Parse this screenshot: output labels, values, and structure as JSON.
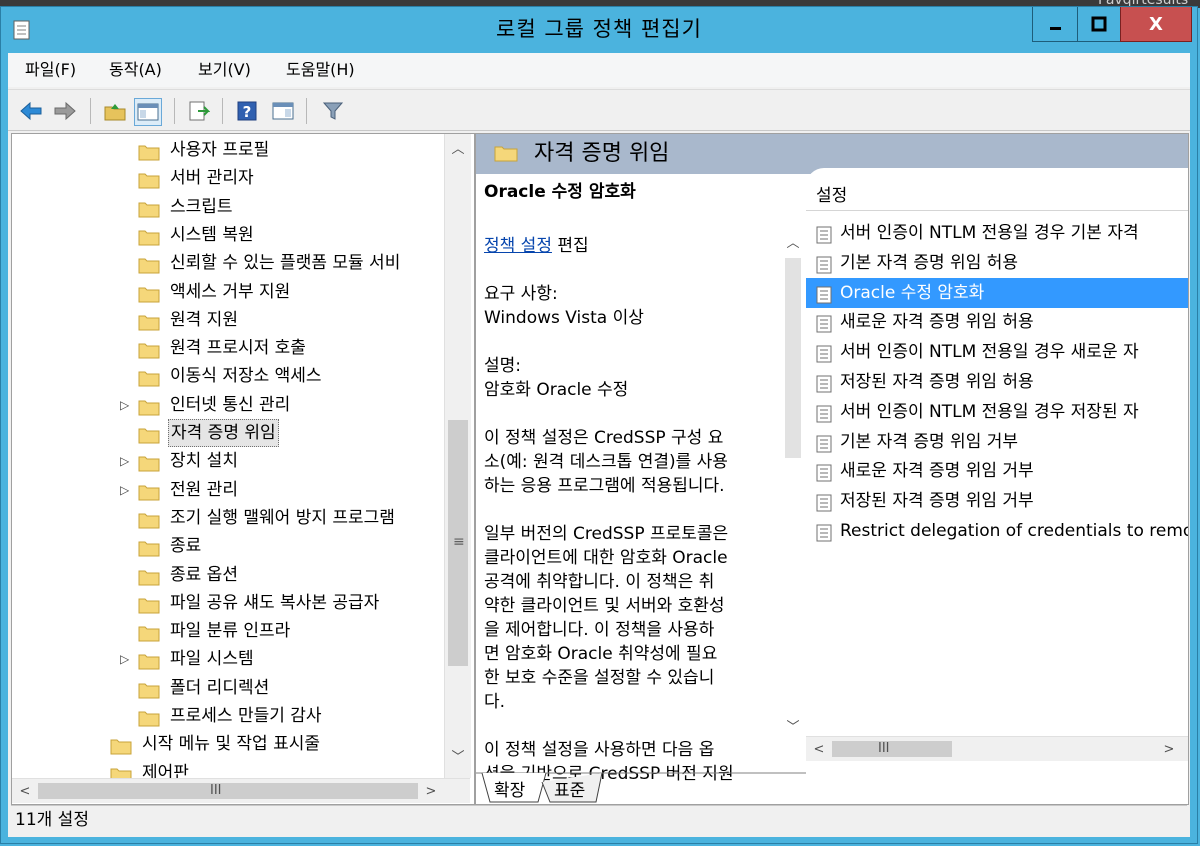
{
  "window": {
    "title": "로컬 그룹 정책 편집기",
    "close_glyph": "X"
  },
  "menu": [
    {
      "label": "파일(F)"
    },
    {
      "label": "동작(A)"
    },
    {
      "label": "보기(V)"
    },
    {
      "label": "도움말(H)"
    }
  ],
  "toolbar": {
    "icons": [
      "back-arrow-icon",
      "forward-arrow-icon",
      "up-folder-icon",
      "show-hide-tree-icon",
      "export-list-icon",
      "help-icon",
      "properties-pane-icon",
      "filter-icon"
    ]
  },
  "tree": {
    "items": [
      {
        "label": "사용자 프로필",
        "expandable": false
      },
      {
        "label": "서버 관리자",
        "expandable": false
      },
      {
        "label": "스크립트",
        "expandable": false
      },
      {
        "label": "시스템 복원",
        "expandable": false
      },
      {
        "label": "신뢰할 수 있는 플랫폼 모듈 서비",
        "expandable": false
      },
      {
        "label": "액세스 거부 지원",
        "expandable": false
      },
      {
        "label": "원격 지원",
        "expandable": false
      },
      {
        "label": "원격 프로시저 호출",
        "expandable": false
      },
      {
        "label": "이동식 저장소 액세스",
        "expandable": false
      },
      {
        "label": "인터넷 통신 관리",
        "expandable": true
      },
      {
        "label": "자격 증명 위임",
        "expandable": false,
        "selected": true
      },
      {
        "label": "장치 설치",
        "expandable": true
      },
      {
        "label": "전원 관리",
        "expandable": true
      },
      {
        "label": "조기 실행 맬웨어 방지 프로그램",
        "expandable": false
      },
      {
        "label": "종료",
        "expandable": false
      },
      {
        "label": "종료 옵션",
        "expandable": false
      },
      {
        "label": "파일 공유 섀도 복사본 공급자",
        "expandable": false
      },
      {
        "label": "파일 분류 인프라",
        "expandable": false
      },
      {
        "label": "파일 시스템",
        "expandable": true
      },
      {
        "label": "폴더 리디렉션",
        "expandable": false
      },
      {
        "label": "프로세스 만들기 감사",
        "expandable": false
      }
    ],
    "parent_items": [
      {
        "label": "시작 메뉴 및 작업 표시줄"
      },
      {
        "label": "제어판"
      }
    ]
  },
  "right": {
    "header": "자격 증명 위임",
    "desc": {
      "title": "Oracle 수정 암호화",
      "link": "정책 설정",
      "edit": " 편집",
      "req_label": "요구 사항:",
      "req_value": "Windows Vista 이상",
      "desc_label": "설명:",
      "desc_value": "암호화 Oracle 수정",
      "para1": [
        "이 정책 설정은 CredSSP 구성 요",
        "소(예: 원격 데스크톱 연결)를 사용",
        "하는 응용 프로그램에 적용됩니다."
      ],
      "para2": [
        "일부 버전의 CredSSP 프로토콜은",
        "클라이언트에 대한 암호화 Oracle",
        "공격에 취약합니다.  이 정책은 취",
        "약한 클라이언트 및 서버와 호환성",
        "을 제어합니다.  이 정책을 사용하",
        "면 암호화 Oracle 취약성에 필요",
        "한 보호 수준을 설정할 수 있습니",
        "다."
      ],
      "para3": [
        "이 정책 설정을 사용하면 다음 옵",
        "션을 기반으로 CredSSP 버전 지원"
      ]
    },
    "list_header": "설정",
    "rows": [
      {
        "label": "서버 인증이 NTLM 전용일 경우 기본 자격"
      },
      {
        "label": "기본 자격 증명 위임 허용"
      },
      {
        "label": "Oracle 수정 암호화",
        "selected": true
      },
      {
        "label": "새로운 자격 증명 위임 허용"
      },
      {
        "label": "서버 인증이 NTLM 전용일 경우 새로운 자"
      },
      {
        "label": "저장된 자격 증명 위임 허용"
      },
      {
        "label": "서버 인증이 NTLM 전용일 경우 저장된 자"
      },
      {
        "label": "기본 자격 증명 위임 거부"
      },
      {
        "label": "새로운 자격 증명 위임 거부"
      },
      {
        "label": "저장된 자격 증명 위임 거부"
      },
      {
        "label": "Restrict delegation of credentials to remote"
      }
    ],
    "tabs": [
      "확장",
      "표준"
    ]
  },
  "status": "11개 설정"
}
